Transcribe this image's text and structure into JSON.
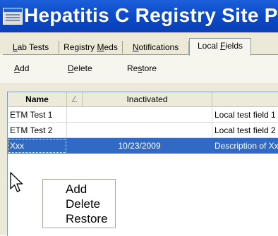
{
  "window": {
    "title": "Hepatitis C Registry Site Pa"
  },
  "tabs": [
    {
      "pre": "",
      "key": "L",
      "post": "ab Tests"
    },
    {
      "pre": "Registry ",
      "key": "M",
      "post": "eds"
    },
    {
      "pre": "",
      "key": "N",
      "post": "otifications"
    },
    {
      "pre": "Local ",
      "key": "F",
      "post": "ields"
    }
  ],
  "toolbar": {
    "add": {
      "pre": "",
      "key": "A",
      "post": "dd"
    },
    "delete": {
      "pre": "",
      "key": "D",
      "post": "elete"
    },
    "restore": {
      "pre": "Re",
      "key": "s",
      "post": "tore"
    }
  },
  "grid": {
    "columns": [
      "Name",
      "",
      "Inactivated",
      ""
    ],
    "rows": [
      {
        "name": "ETM Test 1",
        "inactivated": "",
        "description": "Local test field 1"
      },
      {
        "name": "ETM Test 2",
        "inactivated": "",
        "description": "Local test field 2"
      },
      {
        "name": "Xxx",
        "inactivated": "10/23/2009",
        "description": "Description of Xxx",
        "selected": true
      }
    ]
  },
  "context_menu": {
    "items": [
      "Add",
      "Delete",
      "Restore"
    ]
  },
  "colors": {
    "title_bar": "#0b49c9",
    "selection": "#316ac5",
    "window_bg": "#ece9d8"
  }
}
